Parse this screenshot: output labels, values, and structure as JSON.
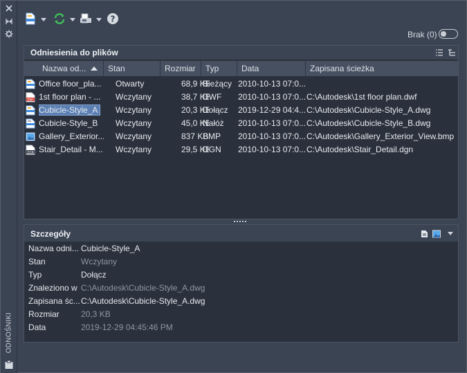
{
  "side": {
    "title": "ODNOŚNIKI"
  },
  "toolbar": {
    "brak_label": "Brak (0)"
  },
  "files": {
    "title": "Odniesienia do plików",
    "columns": [
      "Nazwa od...",
      "Stan",
      "Rozmiar",
      "Typ",
      "Data",
      "Zapisana ścieżka"
    ],
    "rows": [
      {
        "name": "Office floor_pla...",
        "status": "Otwarty",
        "size": "68,9 KB",
        "type": "Bieżący",
        "date": "2010-10-13 07:0...",
        "path": ""
      },
      {
        "name": "1st floor plan - ...",
        "status": "Wczytany",
        "size": "38,7 KB",
        "type": "DWF",
        "date": "2010-10-13 07:0...",
        "path": "C:\\Autodesk\\1st floor plan.dwf"
      },
      {
        "name": "Cubicle-Style_A",
        "status": "Wczytany",
        "size": "20,3 KB",
        "type": "Dołącz",
        "date": "2019-12-29 04:4...",
        "path": "C:\\Autodesk\\Cubicle-Style_A.dwg"
      },
      {
        "name": "Cubicle-Style_B",
        "status": "Wczytany",
        "size": "45,0 KB",
        "type": "Nałóż",
        "date": "2010-10-13 07:0...",
        "path": "C:\\Autodesk\\Cubicle-Style_B.dwg"
      },
      {
        "name": "Gallery_Exterior...",
        "status": "Wczytany",
        "size": "837 KB",
        "type": "BMP",
        "date": "2010-10-13 07:0...",
        "path": "C:\\Autodesk\\Gallery_Exterior_View.bmp"
      },
      {
        "name": "Stair_Detail - M...",
        "status": "Wczytany",
        "size": "29,5 KB",
        "type": "DGN",
        "date": "2010-10-13 07:0...",
        "path": "C:\\Autodesk\\Stair_Detail.dgn"
      }
    ]
  },
  "details": {
    "title": "Szczegóły",
    "fields": [
      {
        "label": "Nazwa odni...",
        "value": "Cubicle-Style_A"
      },
      {
        "label": "Stan",
        "value": "Wczytany"
      },
      {
        "label": "Typ",
        "value": "Dołącz"
      },
      {
        "label": "Znaleziono w",
        "value": "C:\\Autodesk\\Cubicle-Style_A.dwg"
      },
      {
        "label": "Zapisana śc...",
        "value": "C:\\Autodesk\\Cubicle-Style_A.dwg"
      },
      {
        "label": "Rozmiar",
        "value": "20,3 KB"
      },
      {
        "label": "Data",
        "value": "2019-12-29 04:45:46 PM"
      }
    ]
  }
}
